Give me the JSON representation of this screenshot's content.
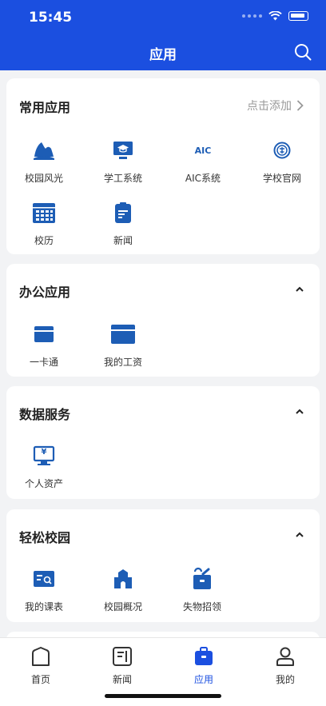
{
  "status": {
    "time": "15:45"
  },
  "header": {
    "title": "应用"
  },
  "sections": [
    {
      "title": "常用应用",
      "action": "点击添加",
      "apps": [
        {
          "label": "校园风光",
          "icon": "landscape-icon"
        },
        {
          "label": "学工系统",
          "icon": "monitor-graduation-icon"
        },
        {
          "label": "AIC系统",
          "icon": "aic-text-icon",
          "icon_text": "AIC"
        },
        {
          "label": "学校官网",
          "icon": "school-emblem-icon"
        },
        {
          "label": "校历",
          "icon": "calendar-icon"
        },
        {
          "label": "新闻",
          "icon": "news-clipboard-icon"
        }
      ]
    },
    {
      "title": "办公应用",
      "apps": [
        {
          "label": "一卡通",
          "icon": "card-icon"
        },
        {
          "label": "我的工资",
          "icon": "salary-card-icon"
        }
      ]
    },
    {
      "title": "数据服务",
      "apps": [
        {
          "label": "个人资产",
          "icon": "monitor-yuan-icon",
          "icon_text": "¥"
        }
      ]
    },
    {
      "title": "轻松校园",
      "apps": [
        {
          "label": "我的课表",
          "icon": "schedule-icon"
        },
        {
          "label": "校园概况",
          "icon": "campus-building-icon"
        },
        {
          "label": "失物招领",
          "icon": "lost-found-bag-icon"
        }
      ]
    }
  ],
  "tabbar": [
    {
      "label": "首页",
      "icon": "home-icon",
      "active": false
    },
    {
      "label": "新闻",
      "icon": "news-icon",
      "active": false
    },
    {
      "label": "应用",
      "icon": "apps-bag-icon",
      "active": true
    },
    {
      "label": "我的",
      "icon": "profile-icon",
      "active": false
    }
  ],
  "colors": {
    "brand": "#1b4fe0",
    "icon_blue": "#1d5db5",
    "background": "#f2f3f5"
  }
}
